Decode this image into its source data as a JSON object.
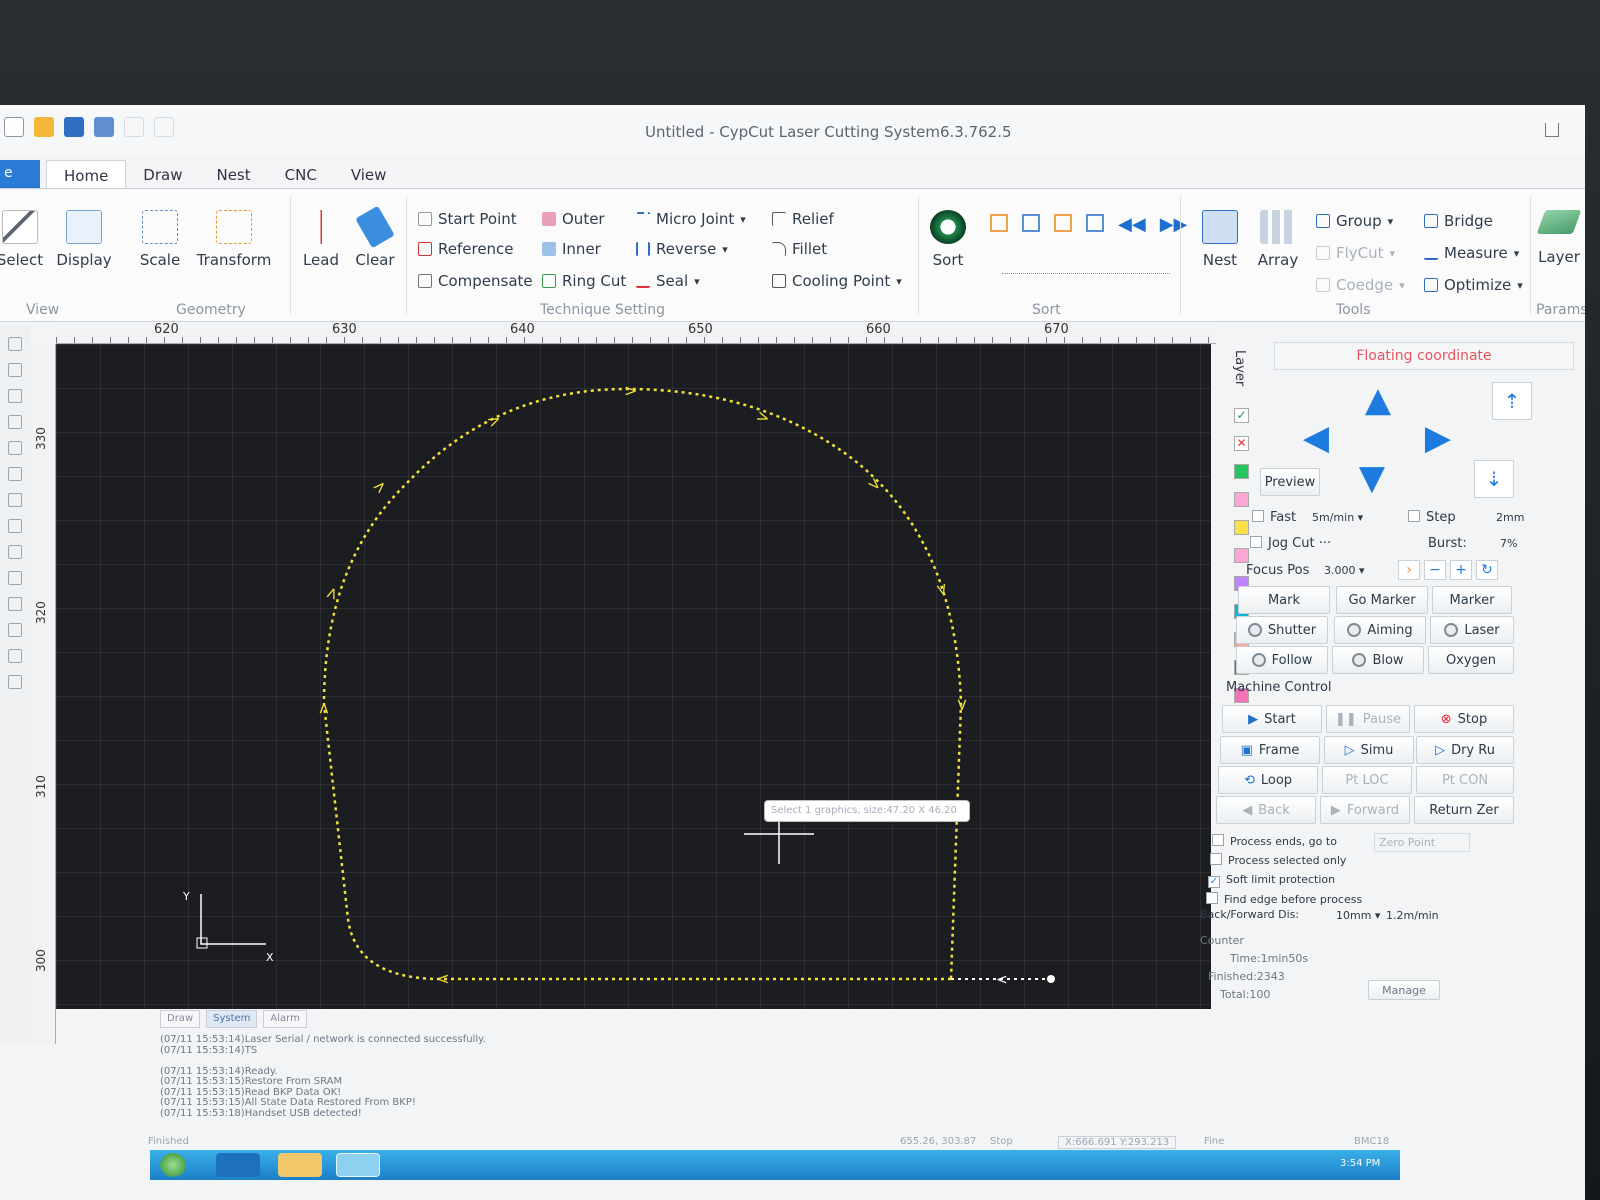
{
  "window": {
    "title": "Untitled - CypCut Laser Cutting System6.3.762.5"
  },
  "tabs": {
    "file": "e",
    "items": [
      "Home",
      "Draw",
      "Nest",
      "CNC",
      "View"
    ]
  },
  "ribbon": {
    "select": "Select",
    "display": "Display",
    "scale": "Scale",
    "transform": "Transform",
    "lead": "Lead",
    "clear": "Clear",
    "start_point": "Start Point",
    "reference": "Reference",
    "compensate": "Compensate",
    "outer": "Outer",
    "inner": "Inner",
    "ring_cut": "Ring Cut",
    "micro_joint": "Micro Joint",
    "reverse": "Reverse",
    "seal": "Seal",
    "relief": "Relief",
    "fillet": "Fillet",
    "cooling_point": "Cooling Point",
    "sort": "Sort",
    "nest": "Nest",
    "array": "Array",
    "group": "Group",
    "flycut": "FlyCut",
    "coedge": "Coedge",
    "bridge": "Bridge",
    "measure": "Measure",
    "optimize": "Optimize",
    "layer": "Layer",
    "groups": {
      "view": "View",
      "geometry": "Geometry",
      "technique": "Technique Setting",
      "sort": "Sort",
      "tools": "Tools",
      "params": "Params"
    }
  },
  "ruler": {
    "h": [
      "620",
      "630",
      "640",
      "650",
      "660",
      "670"
    ],
    "v": [
      "330",
      "320",
      "310",
      "300"
    ]
  },
  "canvas": {
    "tooltip": "Select 1 graphics, size:47.20 X 46.20",
    "axis_x": "X",
    "axis_y": "Y"
  },
  "layer": {
    "title": "Layer",
    "colors": [
      "#22c55e",
      "#f9a8d4",
      "#fde047",
      "#f9a8d4",
      "#c084fc",
      "#06b6d4",
      "#fca5a5",
      "#16a34a",
      "#f472b6",
      "#22d3ee",
      "#2dd4bf",
      "#f472b6",
      "#2563eb"
    ]
  },
  "panel": {
    "floating_coordinate": "Floating coordinate",
    "preview": "Preview",
    "fast": "Fast",
    "speed": "5m/min",
    "step": "Step",
    "step_val": "2mm",
    "jog_cut": "Jog Cut",
    "burst": "Burst:",
    "burst_val": "7%",
    "focus_pos": "Focus Pos",
    "focus_val": "3.000",
    "mark": "Mark",
    "go_marker": "Go Marker",
    "marker": "Marker",
    "shutter": "Shutter",
    "aiming": "Aiming",
    "laser": "Laser",
    "follow": "Follow",
    "blow": "Blow",
    "oxygen": "Oxygen",
    "machine_control": "Machine Control",
    "start": "Start",
    "pause": "Pause",
    "stop": "Stop",
    "frame": "Frame",
    "simu": "Simu",
    "dry_run": "Dry Ru",
    "loop": "Loop",
    "pt_loc": "Pt LOC",
    "pt_con": "Pt CON",
    "back": "Back",
    "forward": "Forward",
    "return_zero": "Return Zer",
    "process_ends": "Process ends, go to",
    "zero_point": "Zero Point",
    "process_selected": "Process selected only",
    "soft_limit": "Soft limit protection",
    "find_edge": "Find edge before process",
    "back_forward_dis": "Back/Forward Dis:",
    "bf_dist": "10mm",
    "bf_speed": "1.2m/min",
    "counter": "Counter",
    "time": "Time:1min50s",
    "finished": "Finished:2343",
    "total": "Total:100",
    "manage": "Manage"
  },
  "logtabs": [
    "Draw",
    "System",
    "Alarm"
  ],
  "log": [
    "(07/11 15:53:14)Laser Serial / network is connected successfully.",
    "(07/11 15:53:14)TS",
    "",
    "(07/11 15:53:14)Ready.",
    "(07/11 15:53:15)Restore From SRAM",
    "(07/11 15:53:15)Read BKP Data OK!",
    "(07/11 15:53:15)All State Data Restored From BKP!",
    "(07/11 15:53:18)Handset USB detected!"
  ],
  "status": {
    "left": "Finished",
    "coord": "655.26, 303.87",
    "stop": "Stop",
    "xy": "X:666.691 Y:293.213",
    "fine": "Fine",
    "bmc": "BMC18",
    "clock": "3:54 PM"
  }
}
